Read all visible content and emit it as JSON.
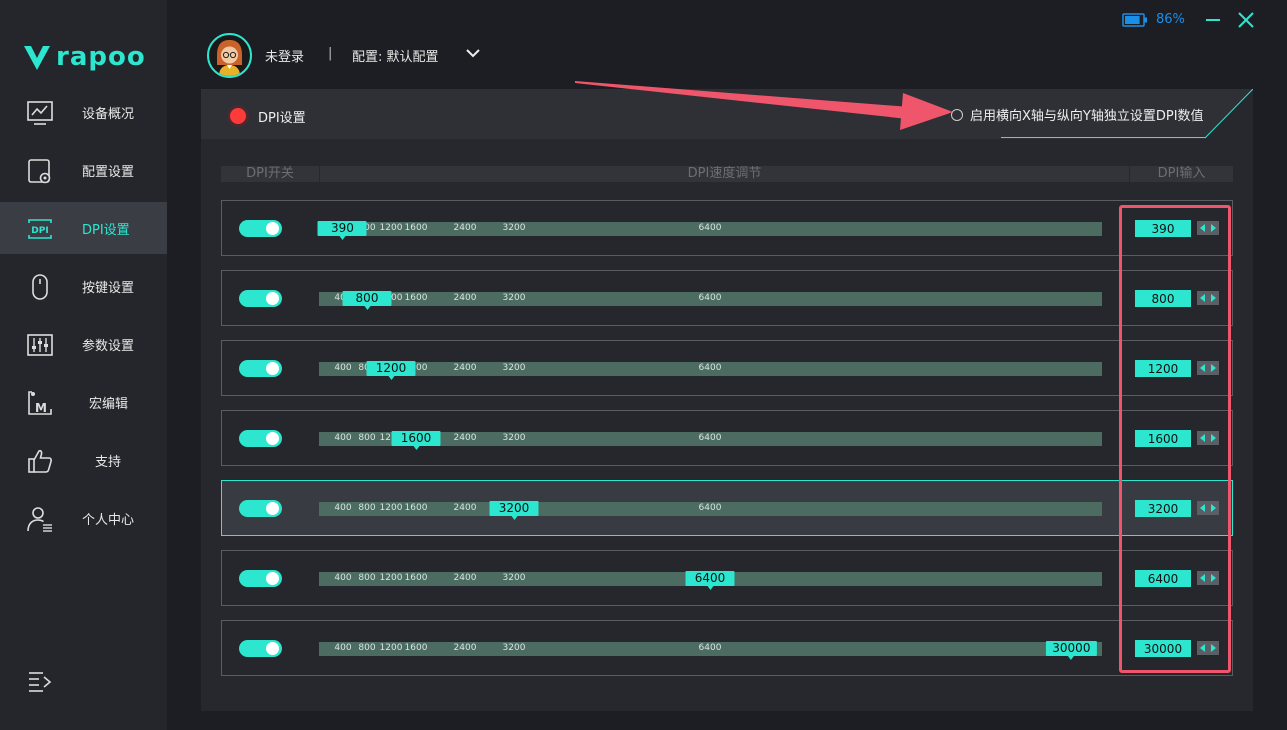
{
  "app": {
    "logo_text": "rapoo"
  },
  "window": {
    "battery_percent": "86%",
    "battery_level": 0.86
  },
  "user": {
    "login_status": "未登录",
    "separator": "|",
    "config_label": "配置: 默认配置"
  },
  "sidebar": {
    "items": [
      {
        "label": "设备概况",
        "icon": "monitor-chart-icon"
      },
      {
        "label": "配置设置",
        "icon": "config-gear-icon"
      },
      {
        "label": "DPI设置",
        "icon": "dpi-icon",
        "active": true
      },
      {
        "label": "按键设置",
        "icon": "mouse-icon"
      },
      {
        "label": "参数设置",
        "icon": "sliders-icon"
      },
      {
        "label": "宏编辑",
        "icon": "macro-icon"
      },
      {
        "label": "支持",
        "icon": "thumbs-up-icon"
      },
      {
        "label": "个人中心",
        "icon": "user-icon"
      }
    ]
  },
  "panel": {
    "title": "DPI设置",
    "independent_xy_label": "启用横向X轴与纵向Y轴独立设置DPI数值",
    "independent_xy_checked": false,
    "columns": {
      "switch": "DPI开关",
      "slider": "DPI速度调节",
      "input": "DPI输入"
    }
  },
  "dpi": {
    "min": 50,
    "max": 32000,
    "ticks": [
      {
        "label": "400",
        "value": 400
      },
      {
        "label": "800",
        "value": 800
      },
      {
        "label": "1200",
        "value": 1200
      },
      {
        "label": "1600",
        "value": 1600
      },
      {
        "label": "2400",
        "value": 2400
      },
      {
        "label": "3200",
        "value": 3200
      },
      {
        "label": "6400",
        "value": 6400
      }
    ],
    "rows": [
      {
        "value": 390,
        "display": "390",
        "enabled": true,
        "selected": false
      },
      {
        "value": 800,
        "display": "800",
        "enabled": true,
        "selected": false
      },
      {
        "value": 1200,
        "display": "1200",
        "enabled": true,
        "selected": false
      },
      {
        "value": 1600,
        "display": "1600",
        "enabled": true,
        "selected": false
      },
      {
        "value": 3200,
        "display": "3200",
        "enabled": true,
        "selected": true
      },
      {
        "value": 6400,
        "display": "6400",
        "enabled": true,
        "selected": false
      },
      {
        "value": 30000,
        "display": "30000",
        "enabled": true,
        "selected": false
      }
    ]
  },
  "colors": {
    "accent": "#2de6cf",
    "annotation": "#f0566b",
    "battery": "#1a8fe8"
  }
}
